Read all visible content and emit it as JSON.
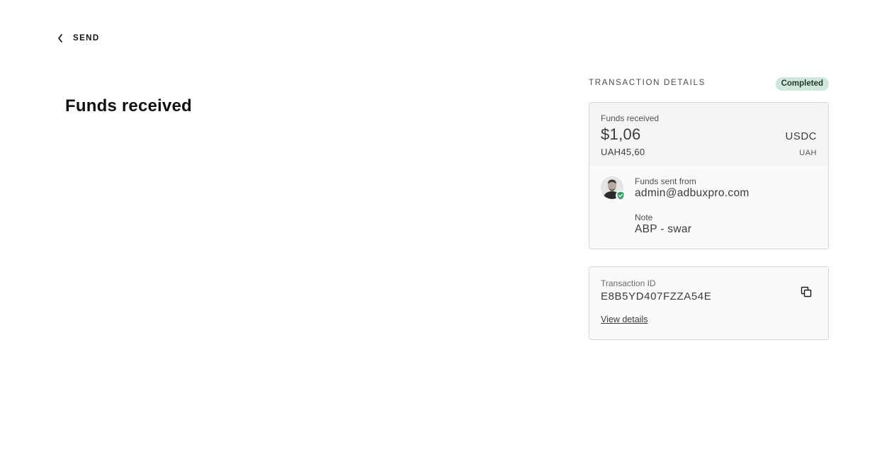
{
  "nav": {
    "back_label": "SEND"
  },
  "page": {
    "title": "Funds received"
  },
  "details": {
    "heading": "TRANSACTION DETAILS",
    "status": "Completed",
    "amount_label": "Funds received",
    "amount_value": "$1,06",
    "amount_currency": "USDC",
    "local_value": "UAH45,60",
    "local_currency": "UAH",
    "sender_label": "Funds sent from",
    "sender_value": "admin@adbuxpro.com",
    "note_label": "Note",
    "note_value": "ABP - swar"
  },
  "transaction": {
    "id_label": "Transaction ID",
    "id_value": "E8B5YD407FZZA54E",
    "view_details_label": "View details"
  },
  "icons": {
    "back": "chevron-left-icon",
    "copy": "copy-icon",
    "verified": "shield-check-icon"
  },
  "colors": {
    "status_bg": "#cfe8dc",
    "verified": "#3aa06c"
  }
}
